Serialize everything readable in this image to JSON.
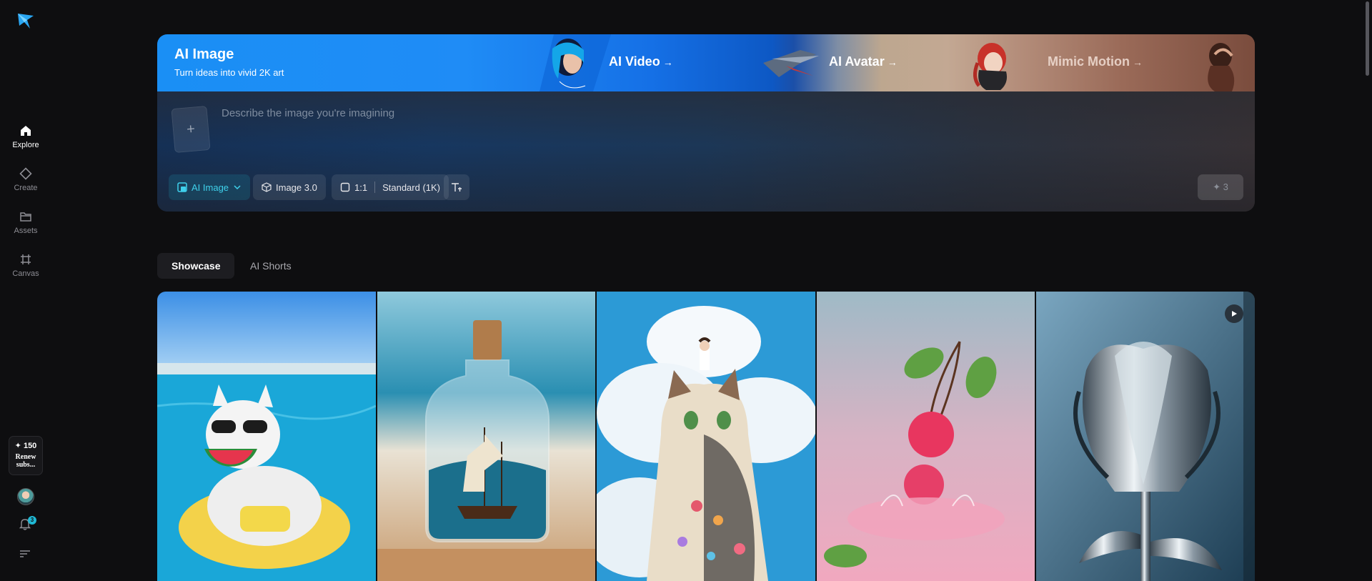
{
  "sidebar": {
    "items": [
      {
        "label": "Explore",
        "icon": "home-icon",
        "active": true
      },
      {
        "label": "Create",
        "icon": "diamond-icon",
        "active": false
      },
      {
        "label": "Assets",
        "icon": "folder-icon",
        "active": false
      },
      {
        "label": "Canvas",
        "icon": "grid-icon",
        "active": false
      }
    ],
    "credits": "✦ 150",
    "renew_label": "Renew subs...",
    "notifications": "3"
  },
  "banner": {
    "title": "AI Image",
    "subtitle": "Turn ideas into vivid 2K art",
    "links": [
      {
        "label": "AI Video",
        "arrow": "→"
      },
      {
        "label": "AI Avatar",
        "arrow": "→"
      },
      {
        "label": "Mimic Motion",
        "arrow": "→"
      }
    ]
  },
  "prompt": {
    "placeholder": "Describe the image you're imagining",
    "upload_symbol": "+"
  },
  "toolbar": {
    "mode_label": "AI Image",
    "model_label": "Image 3.0",
    "ratio_label": "1:1",
    "quality_label": "Standard (1K)",
    "generate_label": "✦ 3"
  },
  "tabs": [
    {
      "label": "Showcase",
      "active": true
    },
    {
      "label": "AI Shorts",
      "active": false
    }
  ],
  "gallery": {
    "items": [
      {
        "subject": "White cat with sunglasses eating watermelon on pool float",
        "type": "image"
      },
      {
        "subject": "Ship in a bottle on a beach",
        "type": "image"
      },
      {
        "subject": "Girl standing on a cloud cat with flowers",
        "type": "image"
      },
      {
        "subject": "Cherries splashing into pink water",
        "type": "image"
      },
      {
        "subject": "Chrome metallic tulip",
        "type": "video"
      }
    ]
  },
  "colors": {
    "accent": "#1fb8d4",
    "background": "#0e0e10",
    "banner_blue": "#1a8ff5"
  }
}
